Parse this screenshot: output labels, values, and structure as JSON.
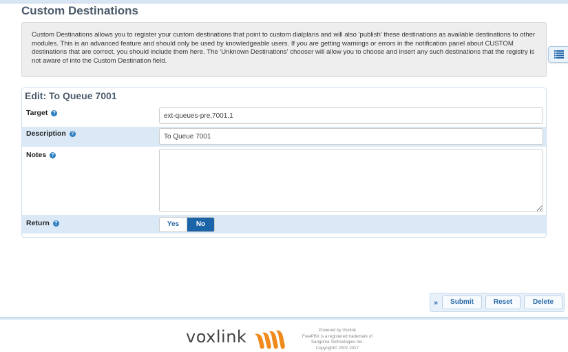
{
  "header": {
    "title": "Custom Destinations"
  },
  "info": {
    "text": "Custom Destinations allows you to register your custom destinations that point to custom dialplans and will also 'publish' these destinations as available destinations to other modules. This is an advanced feature and should only be used by knowledgeable users. If you are getting warnings or errors in the notification panel about CUSTOM destinations that are correct, you should include them here. The 'Unknown Destinations' chooser will allow you to choose and insert any such destinations that the registry is not aware of into the Custom Destination field."
  },
  "form": {
    "title": "Edit: To Queue 7001",
    "target": {
      "label": "Target",
      "value": "ext-queues-pre,7001,1"
    },
    "description": {
      "label": "Description",
      "value": "To Queue 7001"
    },
    "notes": {
      "label": "Notes",
      "value": ""
    },
    "return": {
      "label": "Return",
      "yes": "Yes",
      "no": "No",
      "selected": "No"
    },
    "help_glyph": "?"
  },
  "actions": {
    "arrow": "»",
    "submit": "Submit",
    "reset": "Reset",
    "delete": "Delete"
  },
  "footer": {
    "logo": "voxlink",
    "powered_by": "Powered by Voxlink",
    "trademark": "FreePBX is a registered trademark of",
    "company": "Sangoma Technologies Inc.",
    "copyright": "Copyright© 2007-2017"
  },
  "colors": {
    "accent": "#1c64a8",
    "row_highlight": "#dbe9f6",
    "logo_orange": "#f08a1c"
  },
  "icons": [
    "list-icon",
    "help-icon",
    "double-chevron-right-icon",
    "voxlink-logo-icon"
  ]
}
